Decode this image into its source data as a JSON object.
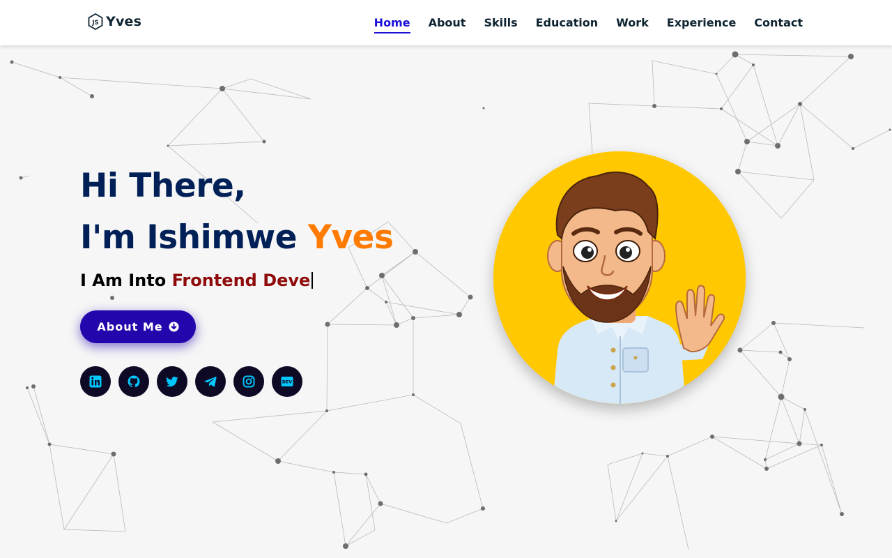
{
  "brand": {
    "name": "Yves",
    "icon": "nodejs-hexagon-icon"
  },
  "nav": {
    "items": [
      {
        "label": "Home",
        "active": true
      },
      {
        "label": "About",
        "active": false
      },
      {
        "label": "Skills",
        "active": false
      },
      {
        "label": "Education",
        "active": false
      },
      {
        "label": "Work",
        "active": false
      },
      {
        "label": "Experience",
        "active": false
      },
      {
        "label": "Contact",
        "active": false
      }
    ]
  },
  "hero": {
    "greeting": "Hi There,",
    "intro_prefix": "I'm Ishimwe ",
    "intro_highlight": "Yves",
    "typed_prefix": "I Am Into ",
    "typed_text": "Frontend Deve",
    "button_label": "About Me",
    "button_icon": "arrow-circle-down-icon"
  },
  "socials": [
    {
      "name": "linkedin",
      "icon": "linkedin-icon"
    },
    {
      "name": "github",
      "icon": "github-icon"
    },
    {
      "name": "twitter",
      "icon": "twitter-icon"
    },
    {
      "name": "telegram",
      "icon": "telegram-icon"
    },
    {
      "name": "instagram",
      "icon": "instagram-icon"
    },
    {
      "name": "dev",
      "icon": "dev-to-icon"
    }
  ],
  "avatar": {
    "icon": "waving-cartoon-avatar"
  },
  "colors": {
    "accent_blue": "#1a0fd6",
    "heading_navy": "#002057",
    "highlight_orange": "#ff7a00",
    "role_red": "#8f0a0a",
    "button_purple": "#2506ad",
    "social_bg": "#0e0a26",
    "social_icon": "#00c8ff",
    "avatar_bg": "#ffc800"
  }
}
